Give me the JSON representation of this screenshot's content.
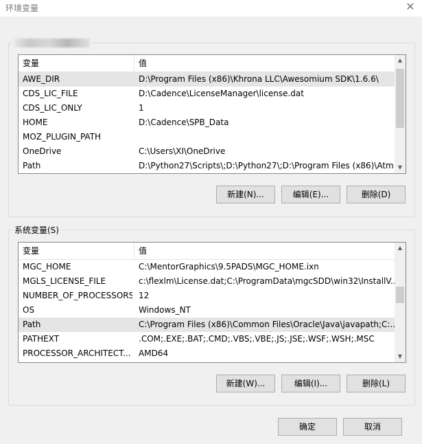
{
  "window": {
    "title": "环境变量",
    "close_glyph": "✕"
  },
  "user_vars": {
    "group_label_blurred": "",
    "columns": {
      "key": "变量",
      "value": "值"
    },
    "rows": [
      {
        "key": "AWE_DIR",
        "value": "D:\\Program Files (x86)\\Khrona LLC\\Awesomium SDK\\1.6.6\\",
        "selected": true
      },
      {
        "key": "CDS_LIC_FILE",
        "value": "D:\\Cadence\\LicenseManager\\license.dat"
      },
      {
        "key": "CDS_LIC_ONLY",
        "value": "1"
      },
      {
        "key": "HOME",
        "value": "D:\\Cadence\\SPB_Data"
      },
      {
        "key": "MOZ_PLUGIN_PATH",
        "value": ""
      },
      {
        "key": "OneDrive",
        "value": "C:\\Users\\XI\\OneDrive"
      },
      {
        "key": "Path",
        "value": "D:\\Python27\\Scripts\\;D:\\Python27\\;D:\\Program Files (x86)\\Atm..."
      }
    ],
    "buttons": {
      "new": "新建(N)...",
      "edit": "编辑(E)...",
      "delete": "删除(D)"
    }
  },
  "system_vars": {
    "group_label": "系统变量(S)",
    "columns": {
      "key": "变量",
      "value": "值"
    },
    "rows": [
      {
        "key": "MGC_HOME",
        "value": "C:\\MentorGraphics\\9.5PADS\\MGC_HOME.ixn"
      },
      {
        "key": "MGLS_LICENSE_FILE",
        "value": "c:\\flexlm\\License.dat;C:\\ProgramData\\mgcSDD\\win32\\InstallV..."
      },
      {
        "key": "NUMBER_OF_PROCESSORS",
        "value": "12"
      },
      {
        "key": "OS",
        "value": "Windows_NT"
      },
      {
        "key": "Path",
        "value": "C:\\Program Files (x86)\\Common Files\\Oracle\\Java\\javapath;C:...",
        "selected": true
      },
      {
        "key": "PATHEXT",
        "value": ".COM;.EXE;.BAT;.CMD;.VBS;.VBE;.JS;.JSE;.WSF;.WSH;.MSC"
      },
      {
        "key": "PROCESSOR_ARCHITECT...",
        "value": "AMD64"
      }
    ],
    "buttons": {
      "new": "新建(W)...",
      "edit": "编辑(I)...",
      "delete": "删除(L)"
    }
  },
  "footer": {
    "ok": "确定",
    "cancel": "取消"
  },
  "icons": {
    "scroll_up": "▲",
    "scroll_down": "▼"
  },
  "colors": {
    "selected_row": "#e5e5e5",
    "button_face": "#e1e1e1",
    "dialog_bg": "#f0f0f0"
  }
}
